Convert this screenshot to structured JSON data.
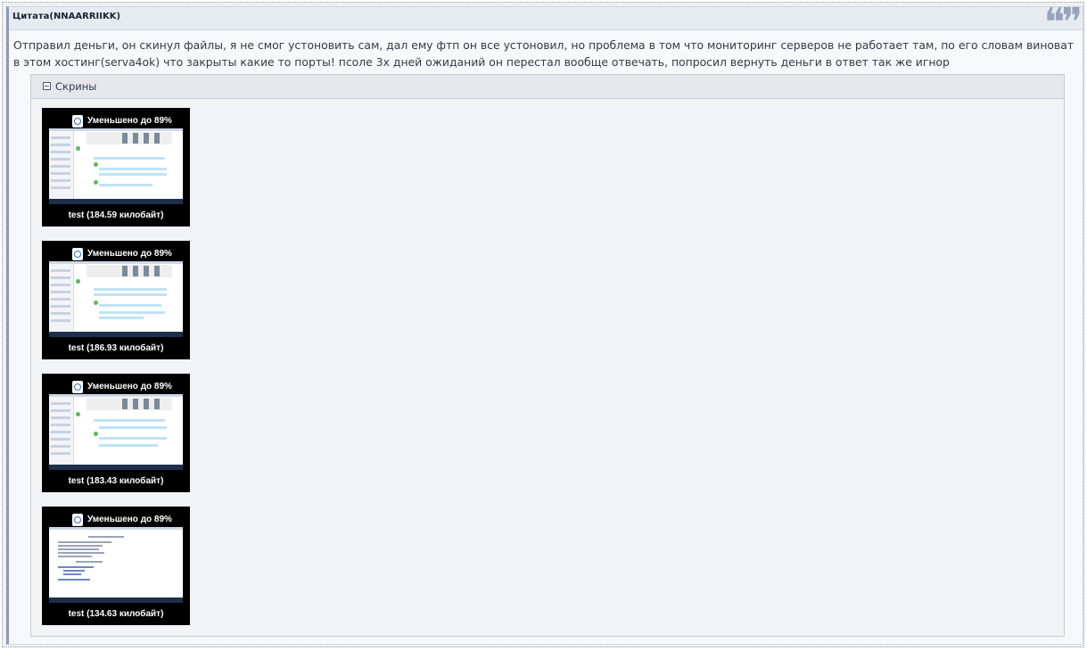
{
  "quote": {
    "title": "Цитата(NNAARRIIKK)",
    "icon": "quote-icon",
    "text": "Отправил деньги, он скинул файлы, я не смог устоновить сам, дал ему фтп он все устоновил, но проблема в том что мониторинг серверов не работает там, по его словам виноват в этом хостинг(serva4ok) что закрыты какие то порты! псоле 3х дней ожиданий он перестал вообще отвечать, попросил вернуть деньги в ответ так же игнор"
  },
  "spoiler": {
    "title": "Скрины",
    "toggle_icon": "collapse-minus-icon",
    "thumbnails": [
      {
        "reduced_label": "Уменьшено до 89%",
        "caption": "test (184.59 килобайт)"
      },
      {
        "reduced_label": "Уменьшено до 89%",
        "caption": "test (186.93 килобайт)"
      },
      {
        "reduced_label": "Уменьшено до 89%",
        "caption": "test (183.43 килобайт)"
      },
      {
        "reduced_label": "Уменьшено до 89%",
        "caption": "test (134.63 килобайт)"
      }
    ]
  },
  "colors": {
    "quote_border": "#8a9ab8",
    "quote_header_bg": "#e6ebf2",
    "thumb_bg": "#000000",
    "chat_row": "#bfe3f5"
  }
}
